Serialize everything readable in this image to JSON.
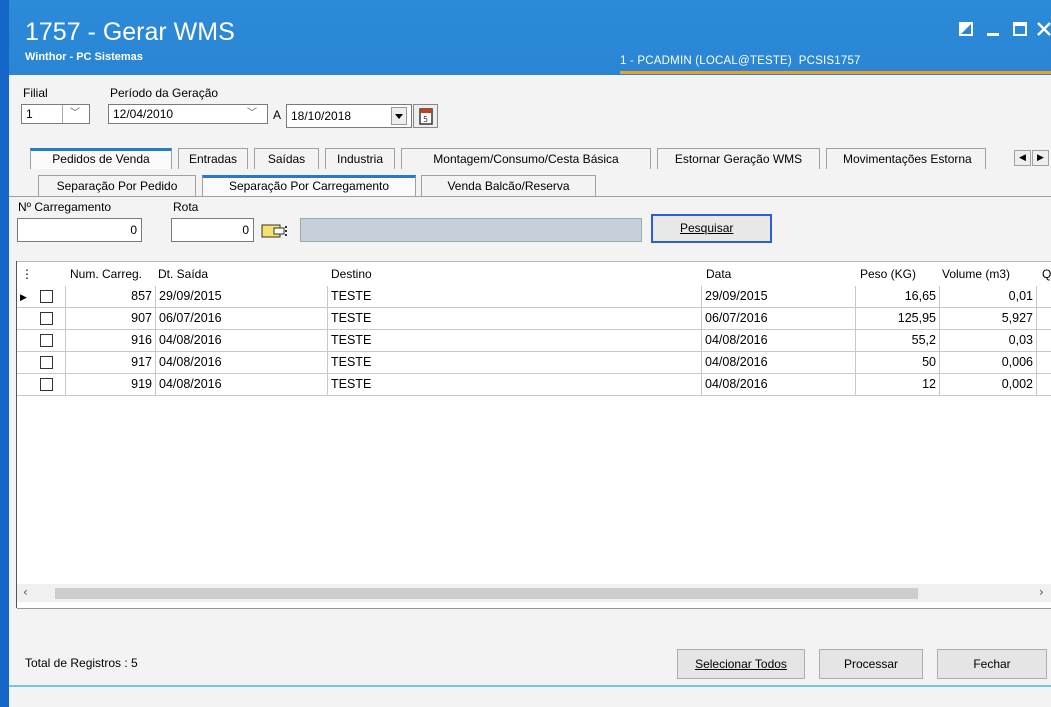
{
  "window": {
    "title": "1757 - Gerar WMS",
    "subtitle": "Winthor - PC Sistemas",
    "user": "1 - PCADMIN (LOCAL@TESTE)",
    "program": "PCSIS1757",
    "accent": "#2a86d4"
  },
  "filters": {
    "filial_label": "Filial",
    "filial_value": "1",
    "periodo_label": "Período da Geração",
    "date_from": "12/04/2010",
    "date_sep": "A",
    "date_to": "18/10/2018"
  },
  "tabs_main": [
    "Pedidos de Venda",
    "Entradas",
    "Saídas",
    "Industria",
    "Montagem/Consumo/Cesta Básica",
    "Estornar Geração WMS",
    "Movimentações Estorna"
  ],
  "tabs_sub": [
    "Separação Por Pedido",
    "Separação Por Carregamento",
    "Venda Balcão/Reserva"
  ],
  "search": {
    "carregamento_label": "Nº Carregamento",
    "carregamento_value": "0",
    "rota_label": "Rota",
    "rota_value": "0",
    "button": "Pesquisar"
  },
  "grid": {
    "columns": [
      "Num. Carreg.",
      "Dt. Saída",
      "Destino",
      "Data",
      "Peso (KG)",
      "Volume (m3)",
      "Q"
    ],
    "rows": [
      {
        "num": "857",
        "dt_saida": "29/09/2015",
        "destino": "TESTE",
        "data": "29/09/2015",
        "peso": "16,65",
        "volume": "0,01"
      },
      {
        "num": "907",
        "dt_saida": "06/07/2016",
        "destino": "TESTE",
        "data": "06/07/2016",
        "peso": "125,95",
        "volume": "5,927"
      },
      {
        "num": "916",
        "dt_saida": "04/08/2016",
        "destino": "TESTE",
        "data": "04/08/2016",
        "peso": "55,2",
        "volume": "0,03"
      },
      {
        "num": "917",
        "dt_saida": "04/08/2016",
        "destino": "TESTE",
        "data": "04/08/2016",
        "peso": "50",
        "volume": "0,006"
      },
      {
        "num": "919",
        "dt_saida": "04/08/2016",
        "destino": "TESTE",
        "data": "04/08/2016",
        "peso": "12",
        "volume": "0,002"
      }
    ]
  },
  "footer": {
    "total": "Total de Registros : 5",
    "btn_select_all": "Selecionar Todos",
    "btn_process": "Processar",
    "btn_close": "Fechar"
  }
}
